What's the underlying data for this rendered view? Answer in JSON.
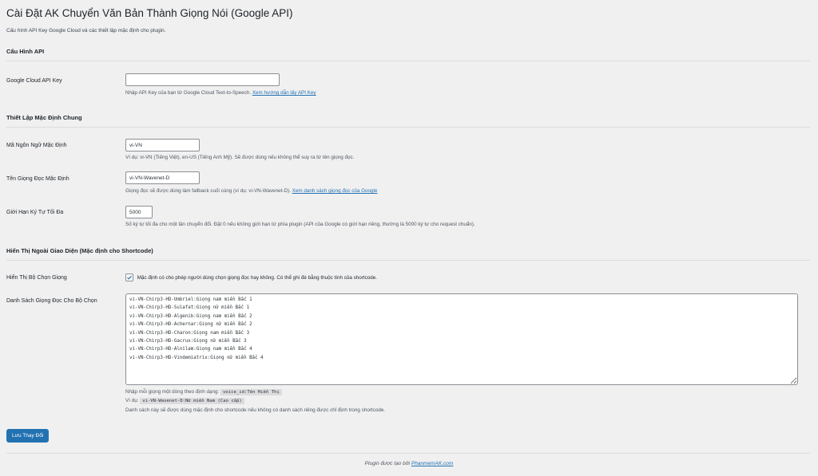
{
  "page": {
    "title": "Cài Đặt AK Chuyển Văn Bản Thành Giọng Nói (Google API)",
    "subtitle": "Cấu hình API Key Google Cloud và các thiết lập mặc định cho plugin."
  },
  "sections": {
    "api": {
      "heading": "Cấu Hình API",
      "api_key_label": "Google Cloud API Key",
      "api_key_value": "",
      "api_key_desc": "Nhập API Key của bạn từ Google Cloud Text-to-Speech.",
      "api_key_link": "Xem hướng dẫn lấy API Key"
    },
    "general": {
      "heading": "Thiết Lập Mặc Định Chung",
      "lang_label": "Mã Ngôn Ngữ Mặc Định",
      "lang_value": "vi-VN",
      "lang_desc": "Ví dụ: vi-VN (Tiếng Việt), en-US (Tiếng Anh Mỹ). Sẽ được dùng nếu không thể suy ra từ tên giọng đọc.",
      "voice_label": "Tên Giọng Đọc Mặc Định",
      "voice_value": "vi-VN-Wavenet-D",
      "voice_desc": "Giọng đọc sẽ được dùng làm fallback cuối cùng (ví dụ: vi-VN-Wavenet-D).",
      "voice_link": "Xem danh sách giọng đọc của Google",
      "limit_label": "Giới Hạn Ký Tự Tối Đa",
      "limit_value": "5000",
      "limit_desc": "Số ký tự tối đa cho một lần chuyển đổi. Đặt 0 nếu không giới hạn từ phía plugin (API của Google có giới hạn riêng, thường là 5000 ký tự cho request chuẩn)."
    },
    "display": {
      "heading": "Hiển Thị Ngoài Giao Diện (Mặc định cho Shortcode)",
      "selector_label": "Hiển Thị Bộ Chọn Giọng",
      "selector_checked": true,
      "selector_desc": "Mặc định có cho phép người dùng chọn giọng đọc hay không. Có thể ghi đè bằng thuộc tính của shortcode.",
      "list_label": "Danh Sách Giọng Đọc Cho Bộ Chọn",
      "list_value": "vi-VN-Chirp3-HD-Umbriel:Giọng nam miền Bắc 1\nvi-VN-Chirp3-HD-Sulafat:Giọng nữ miền Bắc 1\nvi-VN-Chirp3-HD-Algenib:Giọng nam miền Bắc 2\nvi-VN-Chirp3-HD-Achernar:Giọng nữ miền Bắc 2\nvi-VN-Chirp3-HD-Charon:Giọng nam miền Bắc 3\nvi-VN-Chirp3-HD-Gacrux:Giọng nữ miền Bắc 3\nvi-VN-Chirp3-HD-Alnilam:Giọng nam miền Bắc 4\nvi-VN-Chirp3-HD-Vindemiatrix:Giọng nữ miền Bắc 4",
      "format_prefix": "Nhập mỗi giọng một dòng theo định dạng:",
      "format_code": "voice_id:Tên Hiển Thị",
      "example_prefix": "Ví dụ:",
      "example_code": "vi-VN-Wavenet-D:Nữ miền Nam (Cao cấp)",
      "list_desc": "Danh sách này sẽ được dùng mặc định cho shortcode nếu không có danh sách riêng được chỉ định trong shortcode."
    }
  },
  "save_button": "Lưu Thay Đổi",
  "footer": {
    "prefix": "Plugin được tạo bởi",
    "link": "PhanmemAK.com"
  }
}
